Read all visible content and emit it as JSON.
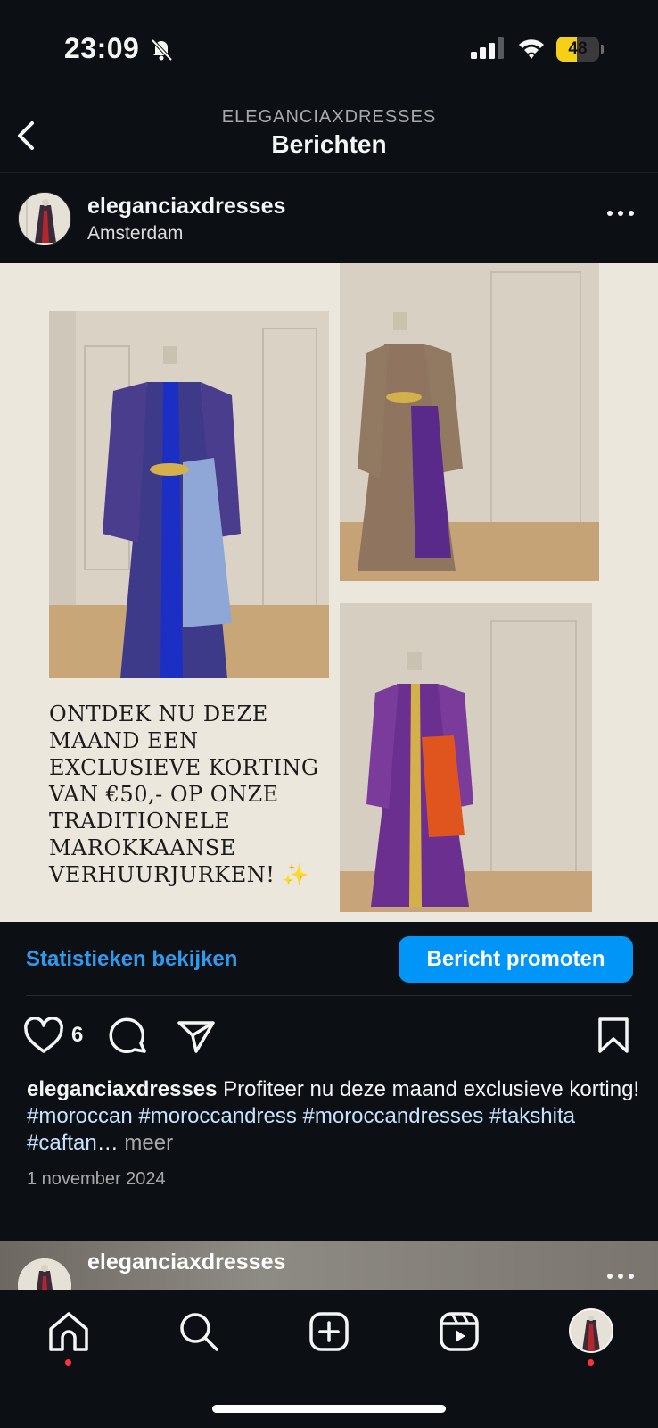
{
  "status_bar": {
    "time": "23:09",
    "battery_level": "48",
    "battery_fraction": 0.48,
    "icons": [
      "bell-slash-icon",
      "cellular-signal-icon",
      "wifi-icon",
      "battery-icon"
    ]
  },
  "header": {
    "account_name": "ELEGANCIAXDRESSES",
    "title": "Berichten",
    "back_icon": "chevron-left-icon"
  },
  "post": {
    "username": "eleganciaxdresses",
    "location": "Amsterdam",
    "image": {
      "promo_text": "ONTDEK NU DEZE MAAND EEN EXCLUSIEVE KORTING VAN €50,- OP ONZE TRADITIONELE MAROKKAANSE VERHUURJURKEN!",
      "promo_emoji": "✨"
    },
    "insights_label": "Statistieken bekijken",
    "promote_label": "Bericht promoten",
    "like_count": "6",
    "caption": {
      "username": "eleganciaxdresses",
      "text": "Profiteer nu deze maand exclusieve korting!",
      "hashtags": [
        "#moroccan",
        "#moroccandress",
        "#moroccandresses",
        "#takshita",
        "#caftan"
      ],
      "ellipsis": "…",
      "more_label": "meer"
    },
    "date": "1 november 2024"
  },
  "next_post": {
    "username": "eleganciaxdresses"
  },
  "tab_bar": {
    "tabs": [
      "home-icon",
      "search-icon",
      "create-icon",
      "reels-icon",
      "profile-avatar"
    ]
  },
  "colors": {
    "background": "#0c1014",
    "accent_blue": "#0095f6",
    "link_blue": "#2f9bf0",
    "notification_red": "#ff3040",
    "battery_yellow": "#f5d016"
  }
}
